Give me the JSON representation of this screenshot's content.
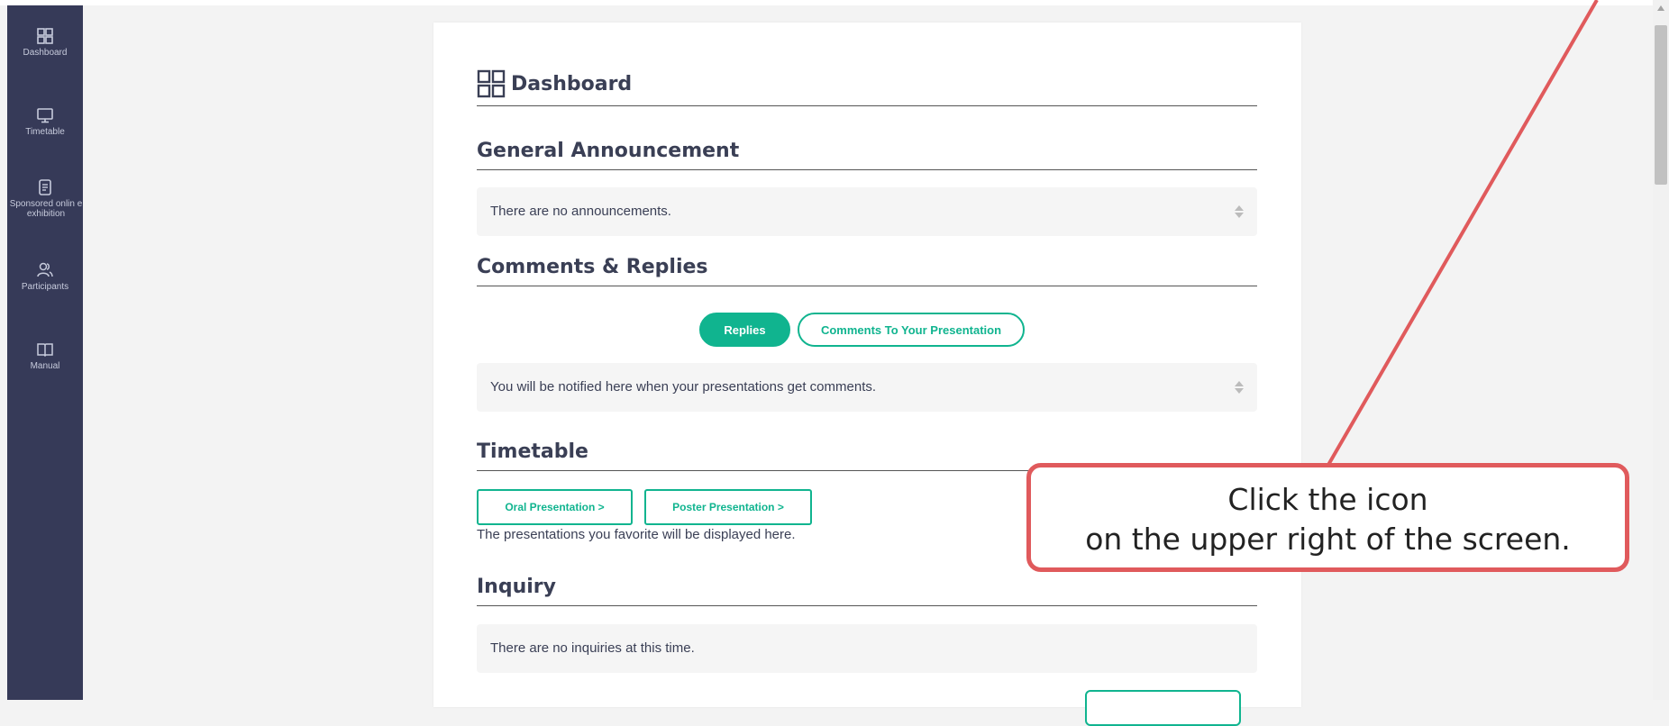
{
  "sidebar": {
    "items": [
      {
        "label": "Dashboard",
        "icon": "dashboard-icon"
      },
      {
        "label": "Timetable",
        "icon": "monitor-icon"
      },
      {
        "label": "Sponsored onlin e exhibition",
        "icon": "document-icon"
      },
      {
        "label": "Participants",
        "icon": "users-icon"
      },
      {
        "label": "Manual",
        "icon": "book-icon"
      }
    ]
  },
  "main": {
    "title": "Dashboard",
    "general": {
      "heading": "General Announcement",
      "empty_text": "There are no announcements."
    },
    "comments": {
      "heading": "Comments & Replies",
      "tabs": [
        {
          "label": "Replies",
          "active": true
        },
        {
          "label": "Comments To Your Presentation",
          "active": false
        }
      ],
      "empty_text": "You will be notified here when your presentations get comments."
    },
    "timetable": {
      "heading": "Timetable",
      "buttons": [
        "Oral Presentation >",
        "Poster Presentation >"
      ],
      "note": "The presentations you favorite will be displayed here."
    },
    "inquiry": {
      "heading": "Inquiry",
      "empty_text": "There are no inquiries at this time."
    }
  },
  "annotation": {
    "line1": "Click the icon",
    "line2": "on the upper right of the screen.",
    "color": "#e05a5c"
  },
  "colors": {
    "sidebar": "#363a58",
    "accent": "#10b48f"
  }
}
